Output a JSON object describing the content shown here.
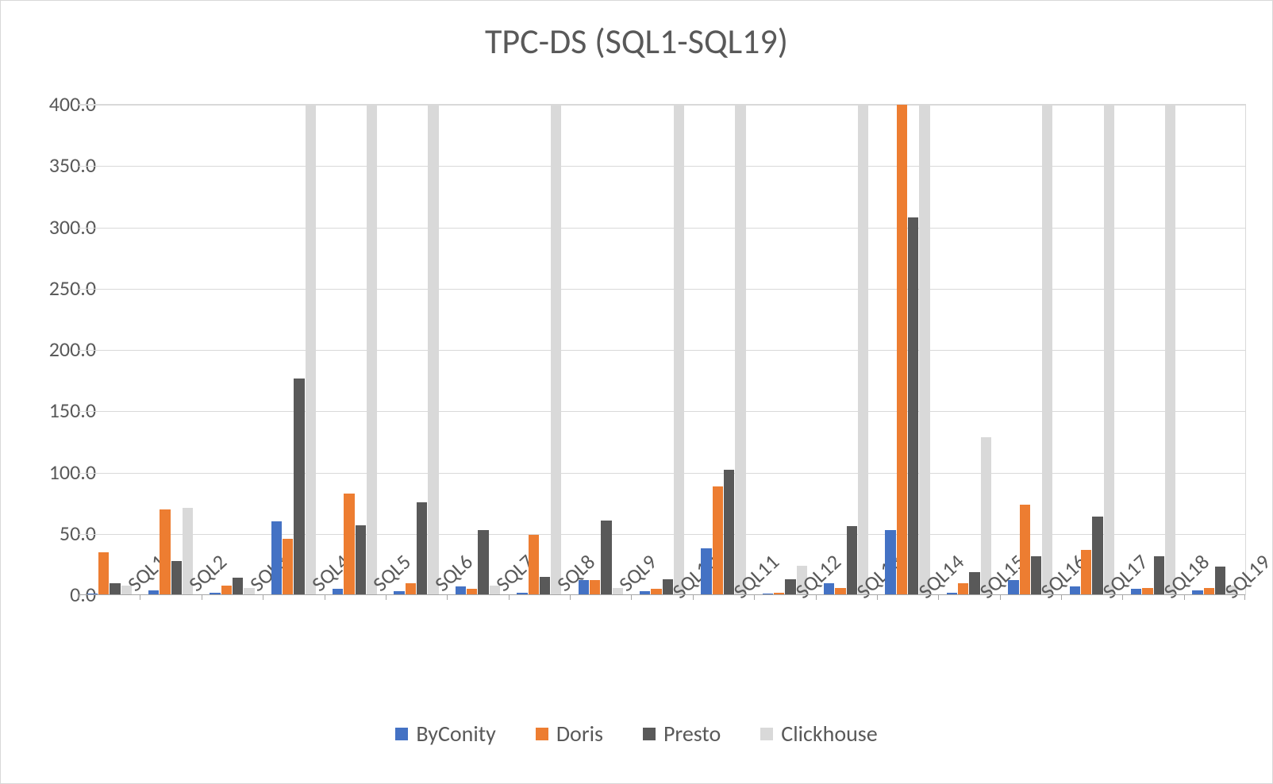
{
  "chart_data": {
    "type": "bar",
    "title": "TPC-DS (SQL1-SQL19)",
    "xlabel": "",
    "ylabel": "",
    "ylim": [
      0,
      400
    ],
    "y_ticks": [
      0.0,
      50.0,
      100.0,
      150.0,
      200.0,
      250.0,
      300.0,
      350.0,
      400.0
    ],
    "categories": [
      "SQL1",
      "SQL2",
      "SQL3",
      "SQL4",
      "SQL5",
      "SQL6",
      "SQL7",
      "SQL8",
      "SQL9",
      "SQL10",
      "SQL11",
      "SQL12",
      "SQL13",
      "SQL14",
      "SQL15",
      "SQL16",
      "SQL17",
      "SQL18",
      "SQL19"
    ],
    "series": [
      {
        "name": "ByConity",
        "color": "#4472c4",
        "values": [
          1,
          4,
          2,
          60,
          5,
          3,
          7,
          2,
          12,
          3,
          38,
          1,
          10,
          53,
          2,
          12,
          7,
          5,
          4
        ]
      },
      {
        "name": "Doris",
        "color": "#ed7d31",
        "values": [
          35,
          70,
          8,
          46,
          83,
          10,
          5,
          49,
          12,
          5,
          89,
          2,
          6,
          400,
          10,
          74,
          37,
          6,
          6
        ]
      },
      {
        "name": "Presto",
        "color": "#595959",
        "values": [
          10,
          28,
          14,
          177,
          57,
          76,
          53,
          15,
          61,
          13,
          102,
          13,
          56,
          308,
          19,
          32,
          64,
          32,
          23
        ]
      },
      {
        "name": "Clickhouse",
        "color": "#d9d9d9",
        "values": [
          8,
          71,
          6,
          400,
          400,
          400,
          8,
          400,
          6,
          400,
          400,
          24,
          400,
          400,
          129,
          400,
          400,
          400,
          8
        ]
      }
    ],
    "legend_position": "bottom",
    "grid": true
  }
}
